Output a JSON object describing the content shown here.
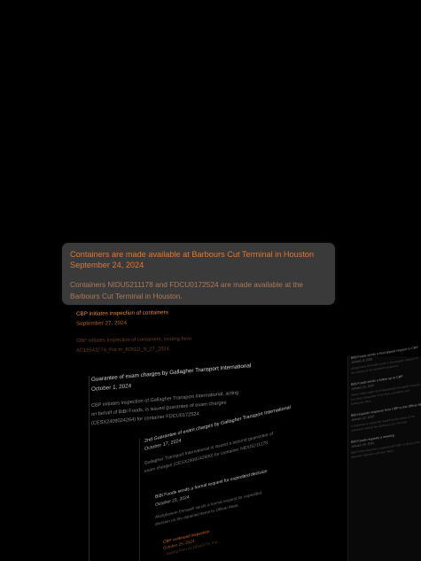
{
  "featured": {
    "title": "Containers are made available at Barbours Cut Terminal in Houston",
    "date": "September 24, 2024",
    "description": "Containers NIDU5211178 and FDCU0172524 are made available at the Barbours Cut Terminal in Houston."
  },
  "timeline": [
    {
      "title": "CBP initiates inspection of containers",
      "date": "September 27, 2024",
      "description": "CBP initiates inspection of containers, issuing form AC16543774_For m_6051D_9_27_2024."
    },
    {
      "title": "Guarantee of exam charges by Gallagher Transport International",
      "date": "October 1, 2024",
      "description": "CBP initiates inspection of Gallagher Transport International, acting on behalf of BiBi Foods, is issued guarantee of exam charges (CESX2409024264) for container FDCU0172524."
    },
    {
      "title": "2nd Guarantee of exam charges by Gallagher Transport International",
      "date": "October 17, 2024",
      "description": "Gallagher Transport International is issued a second guarantee of exam charges (CESX2409242600) for container NIDU5211178."
    },
    {
      "title": "BiBi Foods sends a formal request for expedited decision",
      "date": "October 21, 2024",
      "description": "Abolghasem Esmaeili sends a formal request for expedited decision on the detained items to Officer Mata."
    },
    {
      "title": "CBP continued inspection",
      "date": "October 25, 2024",
      "description": "...issuing form AC16543774_For..."
    }
  ],
  "side_panel": [
    {
      "title": "BiBi Foods sends a final appeal request to CBP",
      "date": "January 8, 2025",
      "description": "Abolghasem Esmaeili sends a final appeal request for the release of the detained containers."
    },
    {
      "title": "BiBi Foods sends a follow up to CBP",
      "date": "January 15, 2025",
      "description": "Officer Mata states that Abolghasem Esmaeili's request has been forwarded to the fines, penalties and forfeitures office."
    },
    {
      "title": "BiBi requests response from CBP to the Officer Mata",
      "date": "January 22, 2025",
      "description": "A response is requested regarding the status of the containers held at the Barbours Cut Terminal."
    },
    {
      "title": "BiBi Foods requests a meeting",
      "date": "January 29, 2025",
      "description": "BiBi Foods requests a meeting with CBP to discuss the detained shipment and next steps."
    }
  ]
}
